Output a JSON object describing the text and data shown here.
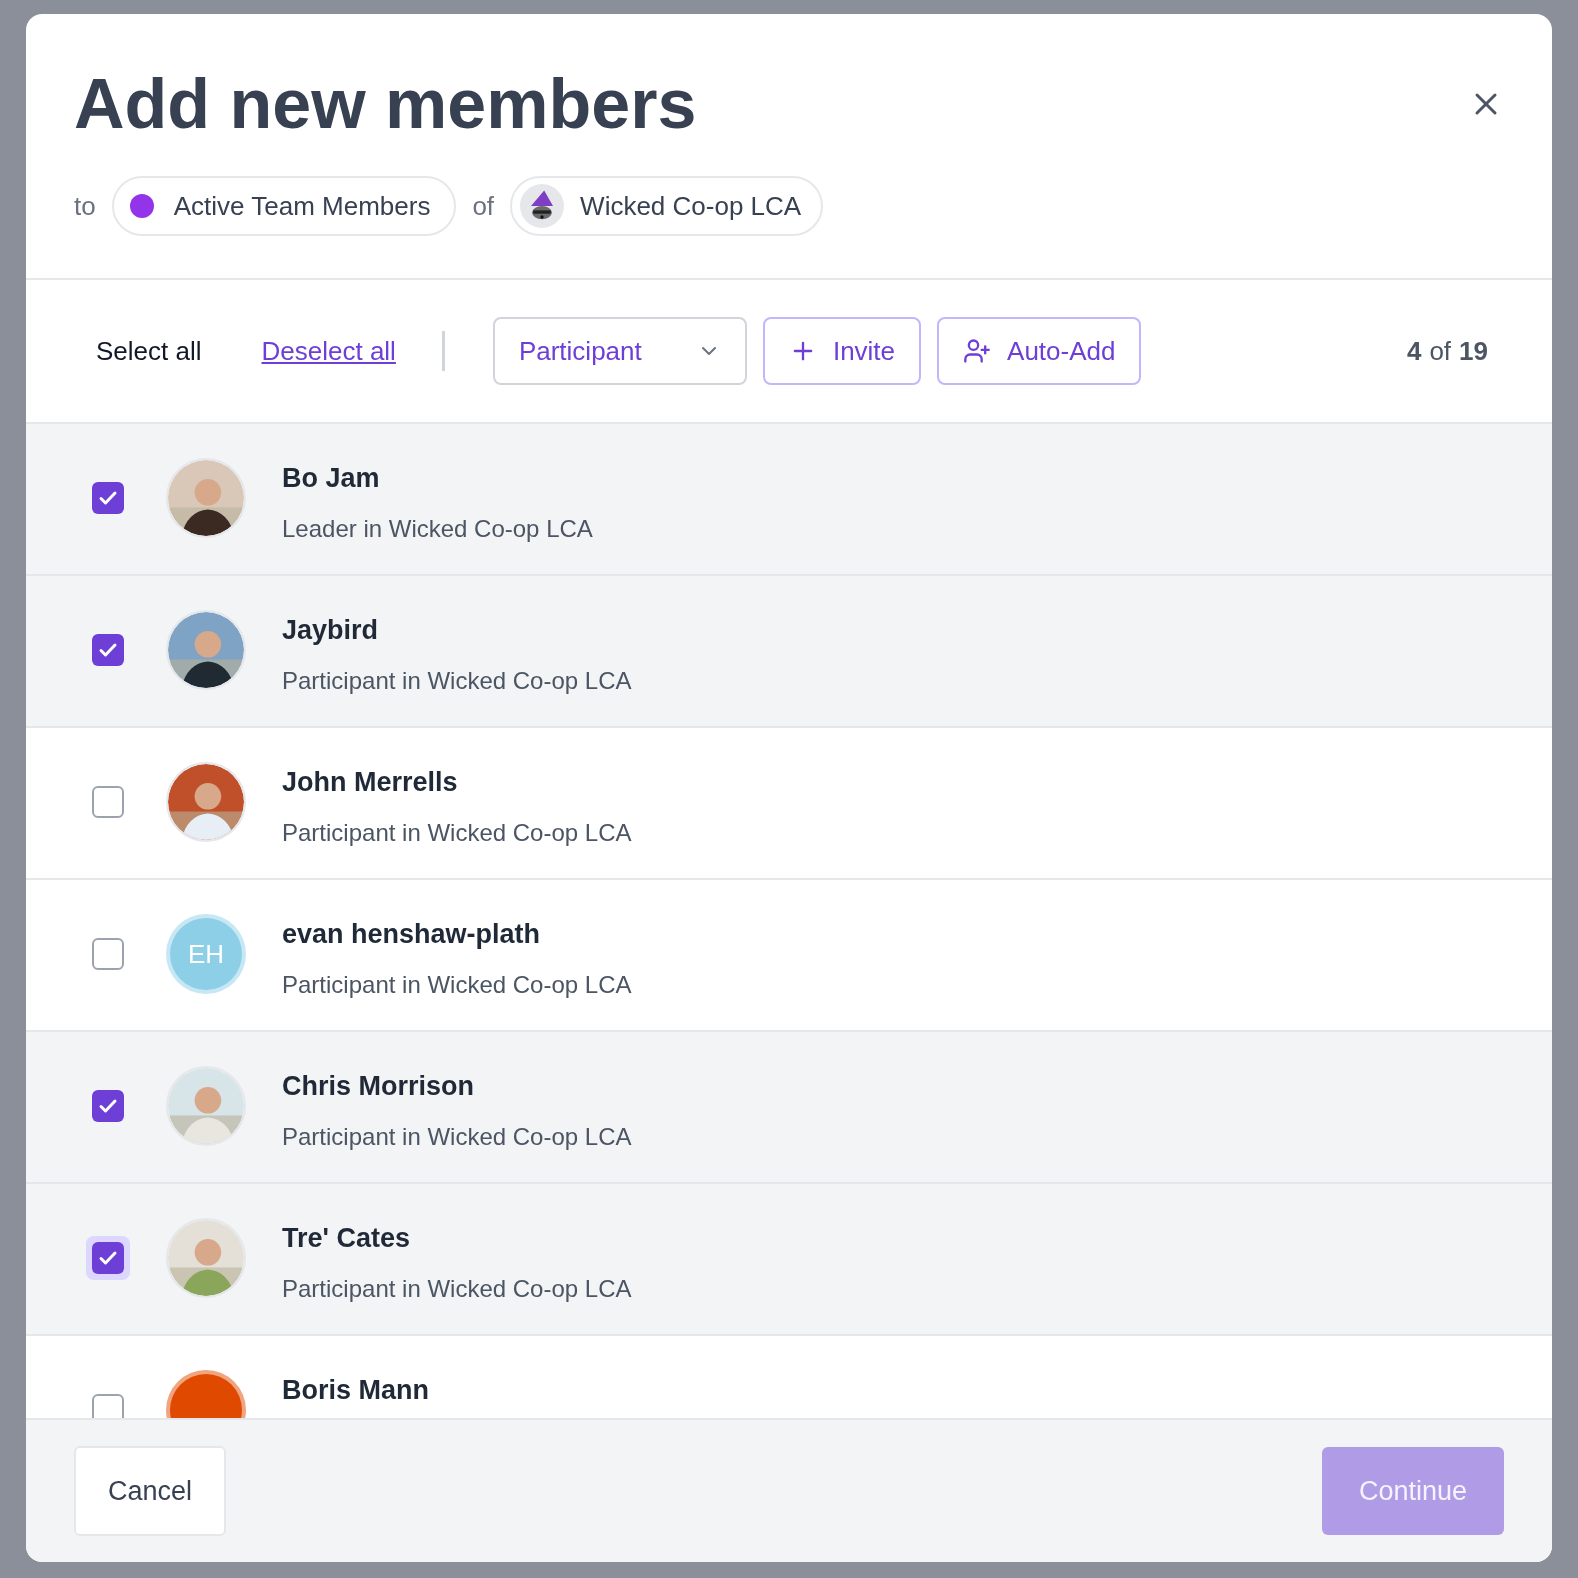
{
  "dialog": {
    "title": "Add new members",
    "to_label": "to",
    "group": {
      "label": "Active Team Members",
      "color": "#9333ea"
    },
    "of_label": "of",
    "organization": {
      "label": "Wicked Co-op LCA"
    }
  },
  "toolbar": {
    "select_all": "Select all",
    "deselect_all": "Deselect all",
    "role": "Participant",
    "invite": "Invite",
    "auto_add": "Auto-Add",
    "count": "4",
    "count_of": "of",
    "total": "19"
  },
  "members": [
    {
      "name": "Bo Jam",
      "subtitle": "Leader in Wicked Co-op LCA",
      "selected": true,
      "focused": false
    },
    {
      "name": "Jaybird",
      "subtitle": "Participant in Wicked Co-op LCA",
      "selected": true,
      "focused": false
    },
    {
      "name": "John Merrells",
      "subtitle": "Participant in Wicked Co-op LCA",
      "selected": false,
      "focused": false
    },
    {
      "name": "evan henshaw-plath",
      "subtitle": "Participant in Wicked Co-op LCA",
      "selected": false,
      "focused": false,
      "avatar": {
        "kind": "initials",
        "initials": "EH",
        "color": "#8ccfe6"
      }
    },
    {
      "name": "Chris Morrison",
      "subtitle": "Participant in Wicked Co-op LCA",
      "selected": true,
      "focused": false
    },
    {
      "name": "Tre' Cates",
      "subtitle": "Participant in Wicked Co-op LCA",
      "selected": true,
      "focused": true
    },
    {
      "name": "Boris Mann",
      "selected": false,
      "focused": false,
      "avatar": {
        "kind": "initials",
        "color": "#e04a00"
      }
    }
  ],
  "footer": {
    "cancel": "Cancel",
    "continue": "Continue"
  }
}
